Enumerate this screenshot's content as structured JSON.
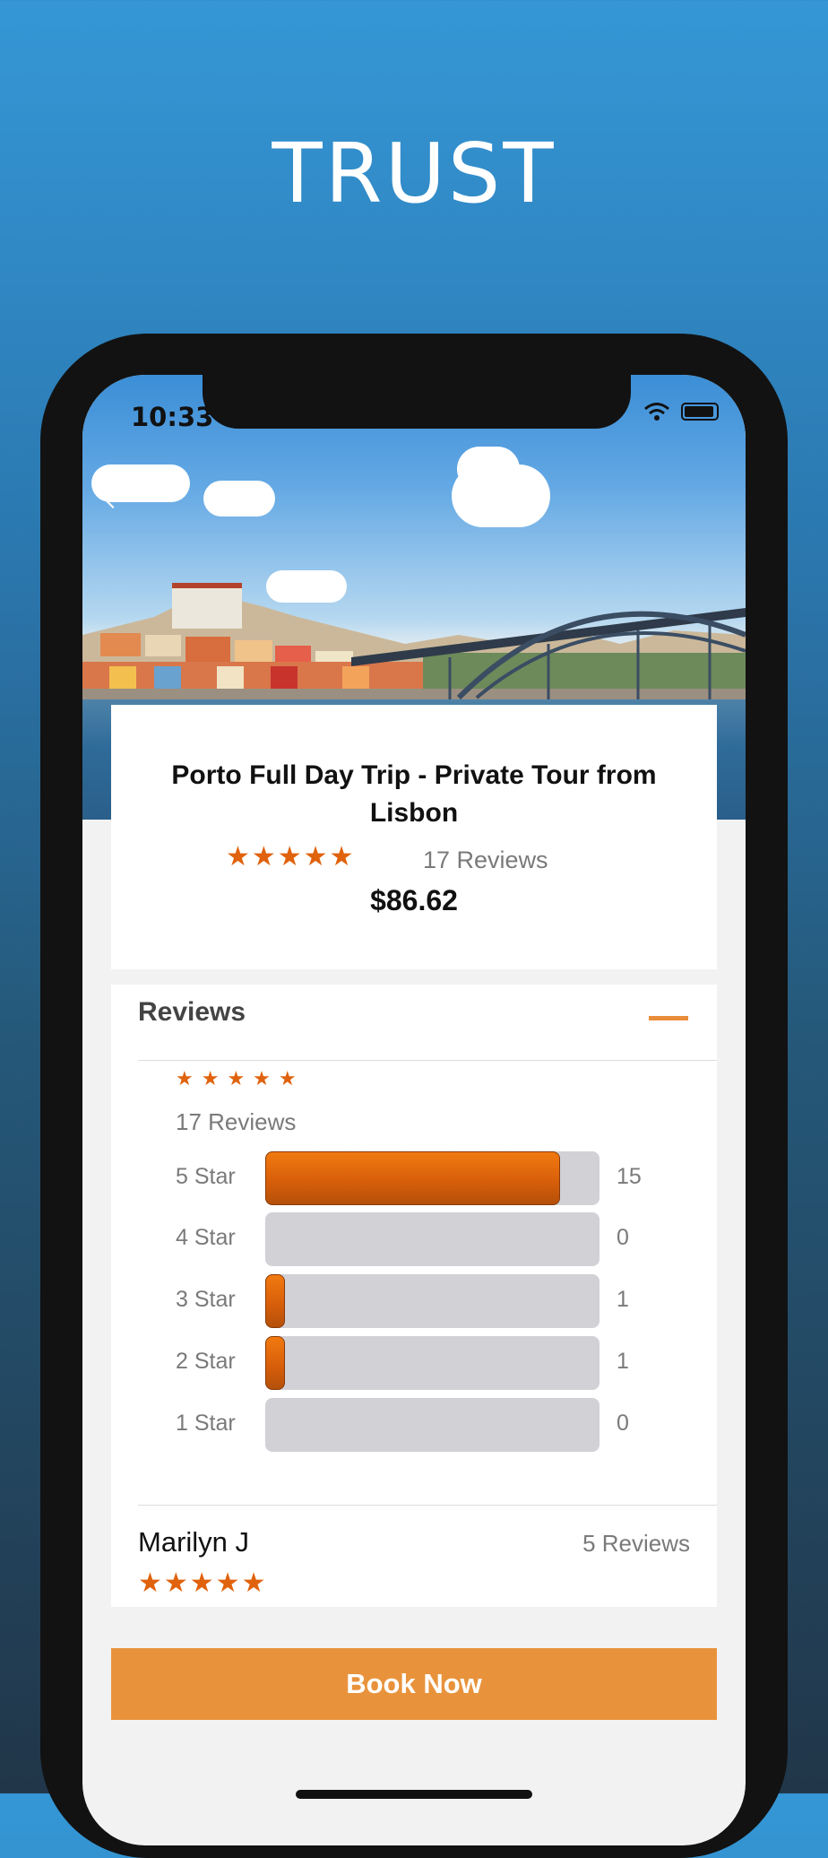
{
  "headline": "TRUST",
  "status_bar": {
    "time": "10:33"
  },
  "tour": {
    "title": "Porto Full Day Trip - Private Tour from Lisbon",
    "stars": "★★★★★",
    "reviews_text": "17 Reviews",
    "price": "$86.62"
  },
  "reviews_section": {
    "heading": "Reviews",
    "summary_stars": "★★★★★",
    "summary_text": "17 Reviews",
    "breakdown": [
      {
        "label": "5 Star",
        "count": "15",
        "fraction": 0.8824
      },
      {
        "label": "4 Star",
        "count": "0",
        "fraction": 0
      },
      {
        "label": "3 Star",
        "count": "1",
        "fraction": 0.0588
      },
      {
        "label": "2 Star",
        "count": "1",
        "fraction": 0.0588
      },
      {
        "label": "1 Star",
        "count": "0",
        "fraction": 0
      }
    ],
    "review": {
      "name": "Marilyn J",
      "count_text": "5 Reviews",
      "stars": "★★★★★"
    }
  },
  "book_button": "Book Now",
  "colors": {
    "accent_orange": "#e0620c",
    "button_orange": "#e8933c",
    "bar_track": "#d1d1d6"
  },
  "icons": [
    "back-arrow-icon",
    "wifi-icon",
    "battery-icon",
    "collapse-minus-icon",
    "star-icon"
  ]
}
